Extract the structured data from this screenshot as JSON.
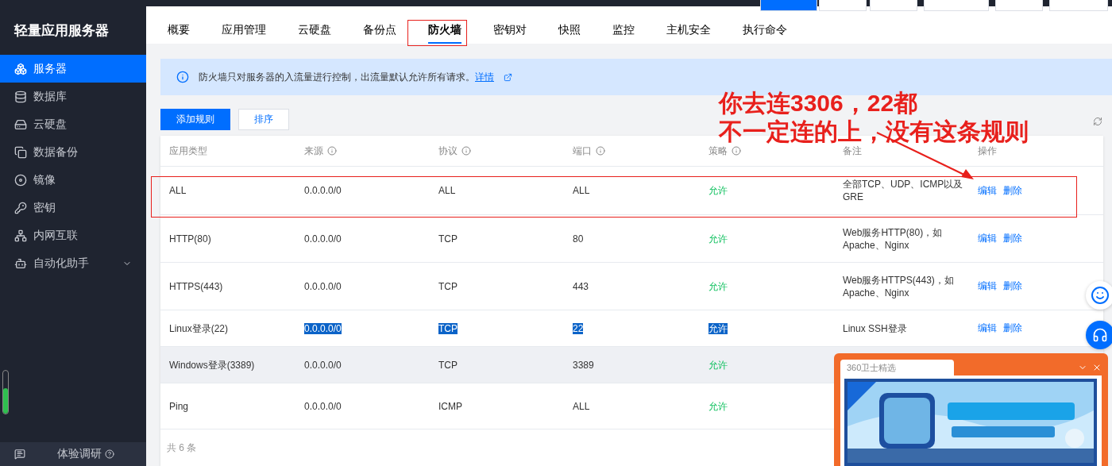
{
  "sidebar": {
    "title": "轻量应用服务器",
    "items": [
      {
        "label": "服务器",
        "selected": true,
        "expandable": false
      },
      {
        "label": "数据库",
        "selected": false,
        "expandable": false
      },
      {
        "label": "云硬盘",
        "selected": false,
        "expandable": false
      },
      {
        "label": "数据备份",
        "selected": false,
        "expandable": false
      },
      {
        "label": "镜像",
        "selected": false,
        "expandable": false
      },
      {
        "label": "密钥",
        "selected": false,
        "expandable": false
      },
      {
        "label": "内网互联",
        "selected": false,
        "expandable": false
      },
      {
        "label": "自动化助手",
        "selected": false,
        "expandable": true
      }
    ],
    "survey": "体验调研",
    "meter": {
      "level": 0.6
    }
  },
  "tabs": [
    {
      "label": "概要",
      "selected": false
    },
    {
      "label": "应用管理",
      "selected": false
    },
    {
      "label": "云硬盘",
      "selected": false
    },
    {
      "label": "备份点",
      "selected": false
    },
    {
      "label": "防火墙",
      "selected": true
    },
    {
      "label": "密钥对",
      "selected": false
    },
    {
      "label": "快照",
      "selected": false
    },
    {
      "label": "监控",
      "selected": false
    },
    {
      "label": "主机安全",
      "selected": false
    },
    {
      "label": "执行命令",
      "selected": false
    }
  ],
  "notice": {
    "text": "防火墙只对服务器的入流量进行控制，出流量默认允许所有请求。",
    "link": "详情"
  },
  "buttons": [
    {
      "label": "添加规则",
      "primary": true
    },
    {
      "label": "排序",
      "primary": false
    }
  ],
  "table": {
    "columns": [
      {
        "label": "应用类型",
        "kind": "plain"
      },
      {
        "label": "来源",
        "kind": "hint"
      },
      {
        "label": "协议",
        "kind": "hint"
      },
      {
        "label": "端口",
        "kind": "hint"
      },
      {
        "label": "策略",
        "kind": "hint"
      },
      {
        "label": "备注",
        "kind": "plain"
      },
      {
        "label": "操作",
        "kind": "plain"
      }
    ],
    "rows": [
      {
        "type": "ALL",
        "source": "0.0.0.0/0",
        "protocol": "ALL",
        "port": "ALL",
        "policy": "允许",
        "note": "全部TCP、UDP、ICMP以及GRE",
        "actions": [
          "编辑",
          "删除"
        ],
        "hovered": false,
        "text_selected": false
      },
      {
        "type": "HTTP(80)",
        "source": "0.0.0.0/0",
        "protocol": "TCP",
        "port": "80",
        "policy": "允许",
        "note": "Web服务HTTP(80)，如Apache、Nginx",
        "actions": [
          "编辑",
          "删除"
        ],
        "hovered": false,
        "text_selected": false
      },
      {
        "type": "HTTPS(443)",
        "source": "0.0.0.0/0",
        "protocol": "TCP",
        "port": "443",
        "policy": "允许",
        "note": "Web服务HTTPS(443)，如Apache、Nginx",
        "actions": [
          "编辑",
          "删除"
        ],
        "hovered": false,
        "text_selected": false
      },
      {
        "type": "Linux登录(22)",
        "source": "0.0.0.0/0",
        "protocol": "TCP",
        "port": "22",
        "policy": "允许",
        "note": "Linux SSH登录",
        "actions": [
          "编辑",
          "删除"
        ],
        "hovered": false,
        "text_selected": true
      },
      {
        "type": "Windows登录(3389)",
        "source": "0.0.0.0/0",
        "protocol": "TCP",
        "port": "3389",
        "policy": "允许",
        "hovered": true,
        "text_selected": false
      },
      {
        "type": "Ping",
        "source": "0.0.0.0/0",
        "protocol": "ICMP",
        "port": "ALL",
        "policy": "允许",
        "hovered": false,
        "text_selected": false
      }
    ],
    "total": "共 6 条"
  },
  "annotation": {
    "lines": [
      "你去连3306，22都",
      "不一定连的上，没有这条规则"
    ]
  },
  "popup": {
    "title": "360卫士精选",
    "kind": "picture"
  }
}
